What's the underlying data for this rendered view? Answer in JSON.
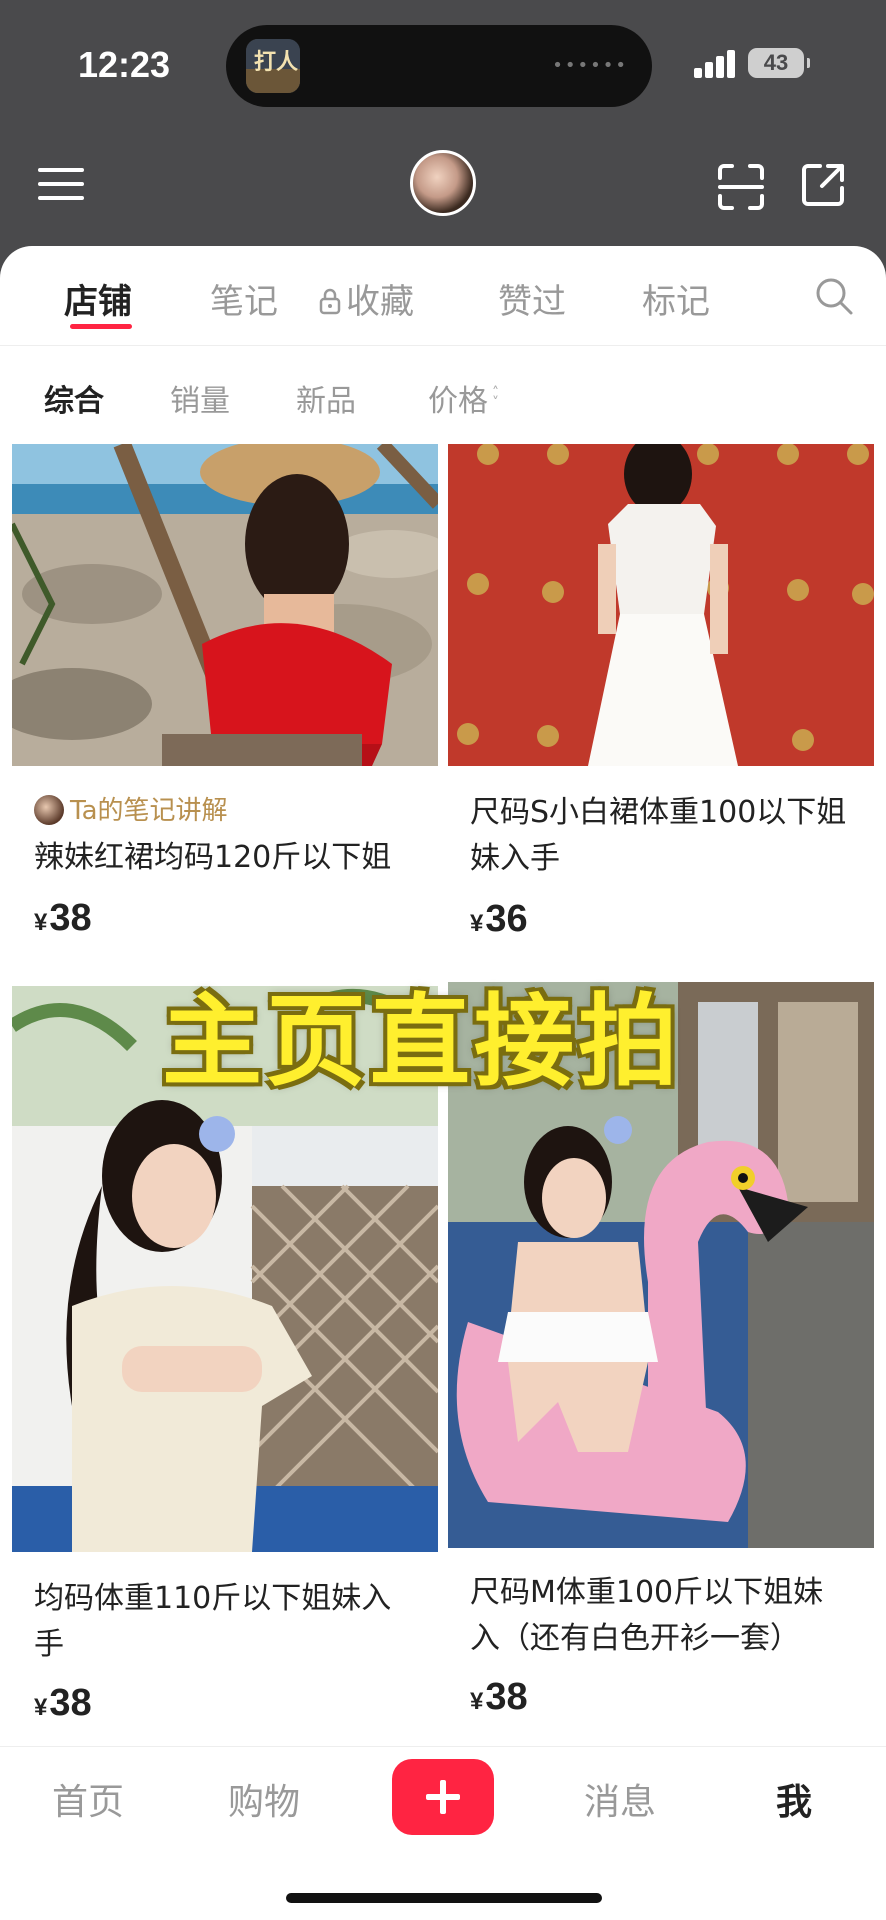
{
  "status_bar": {
    "time": "12:23",
    "battery": "43",
    "island_art_text": "打人"
  },
  "header": {
    "menu_icon": "menu-icon",
    "scan_icon": "scan-icon",
    "share_icon": "share-icon"
  },
  "tabs": [
    {
      "label": "店铺",
      "active": true
    },
    {
      "label": "笔记",
      "active": false
    },
    {
      "label": "收藏",
      "active": false,
      "icon": "lock-icon"
    },
    {
      "label": "赞过",
      "active": false
    },
    {
      "label": "标记",
      "active": false
    }
  ],
  "sort": [
    {
      "label": "综合",
      "active": true
    },
    {
      "label": "销量",
      "active": false
    },
    {
      "label": "新品",
      "active": false
    },
    {
      "label": "价格",
      "active": false,
      "icon": "sort-arrows-icon"
    }
  ],
  "products": [
    {
      "note": "Ta的笔记讲解",
      "title": "辣妹红裙均码120斤以下姐",
      "currency": "¥",
      "price": "38"
    },
    {
      "title": "尺码S小白裙体重100以下姐妹入手",
      "currency": "¥",
      "price": "36"
    },
    {
      "title": "均码体重110斤以下姐妹入手",
      "currency": "¥",
      "price": "38"
    },
    {
      "title": "尺码M体重100斤以下姐妹入（还有白色开衫一套）",
      "currency": "¥",
      "price": "38"
    }
  ],
  "overlay_caption": "主页直接拍",
  "bottom_nav": {
    "home": "首页",
    "shop": "购物",
    "messages": "消息",
    "me": "我"
  },
  "colors": {
    "accent": "#ff2442",
    "note": "#b8904f",
    "caption": "#ffef2e"
  }
}
